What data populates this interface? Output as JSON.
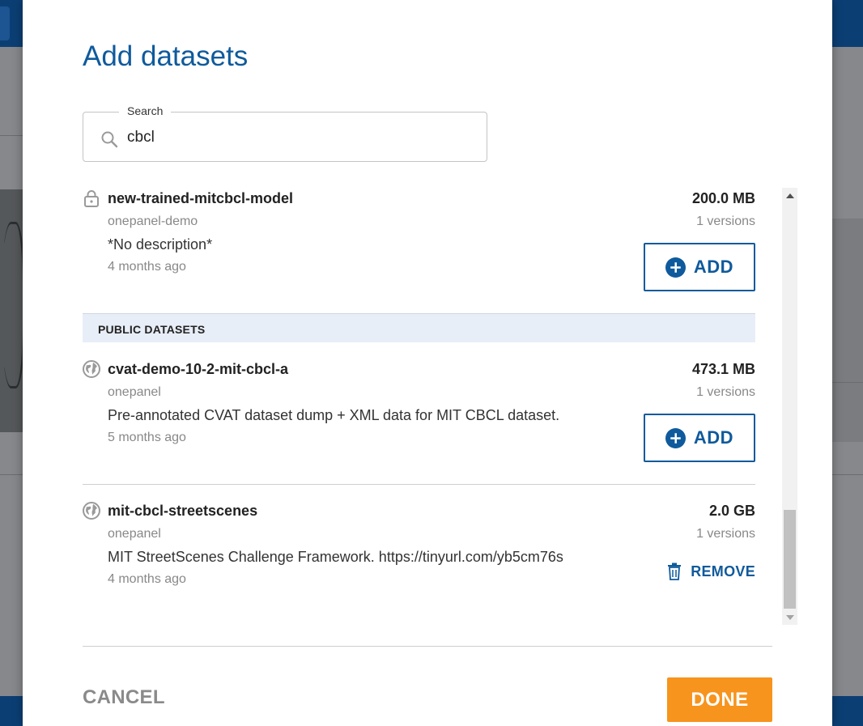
{
  "dialog": {
    "title": "Add datasets",
    "search": {
      "label": "Search",
      "value": "cbcl"
    },
    "add_label": "ADD",
    "remove_label": "REMOVE",
    "cancel_label": "CANCEL",
    "done_label": "DONE"
  },
  "private_items": [
    {
      "icon": "lock-icon",
      "name": "new-trained-mitcbcl-model",
      "owner": "onepanel-demo",
      "description": "*No description*",
      "time": "4 months ago",
      "size": "200.0 MB",
      "versions": "1 versions",
      "action": "add"
    }
  ],
  "public_section": {
    "label": "PUBLIC DATASETS",
    "items": [
      {
        "icon": "globe-icon",
        "name": "cvat-demo-10-2-mit-cbcl-a",
        "owner": "onepanel",
        "description": "Pre-annotated CVAT dataset dump + XML data for MIT CBCL dataset.",
        "time": "5 months ago",
        "size": "473.1 MB",
        "versions": "1 versions",
        "action": "add"
      },
      {
        "icon": "globe-icon",
        "name": "mit-cbcl-streetscenes",
        "owner": "onepanel",
        "description": "MIT StreetScenes Challenge Framework. https://tinyurl.com/yb5cm76s",
        "time": "4 months ago",
        "size": "2.0 GB",
        "versions": "1 versions",
        "action": "remove"
      }
    ]
  },
  "colors": {
    "primary": "#0f5a9c",
    "done": "#f7941d",
    "section_bg": "#e8eef7"
  }
}
